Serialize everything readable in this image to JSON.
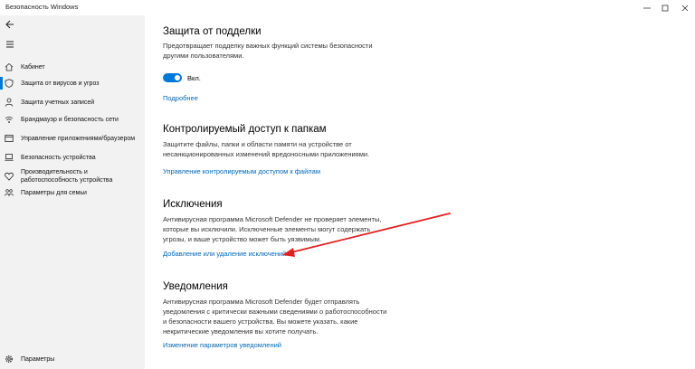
{
  "window": {
    "title": "Безопасность Windows",
    "controls": {
      "minimize": "—",
      "maximize": "☐",
      "close": "✕"
    }
  },
  "sidebar": {
    "items": [
      {
        "label": "Кабинет",
        "icon": "home-icon"
      },
      {
        "label": "Защита от вирусов и угроз",
        "icon": "shield-icon",
        "active": true
      },
      {
        "label": "Защита учетных записей",
        "icon": "person-icon"
      },
      {
        "label": "Брандмауэр и безопасность сети",
        "icon": "wifi-icon"
      },
      {
        "label": "Управление приложениями/браузером",
        "icon": "app-browser-icon"
      },
      {
        "label": "Безопасность устройства",
        "icon": "laptop-icon"
      },
      {
        "label": "Производительность и работоспособность устройства",
        "icon": "heart-icon"
      },
      {
        "label": "Параметры для семьи",
        "icon": "family-icon"
      }
    ],
    "settings_label": "Параметры"
  },
  "main": {
    "tamper": {
      "title": "Защита от подделки",
      "desc": "Предотвращает подделку важных функций системы безопасности другими пользователями.",
      "toggle_label": "Вкл.",
      "toggle_on": true,
      "link": "Подробнее"
    },
    "folder_access": {
      "title": "Контролируемый доступ к папкам",
      "desc": "Защитите файлы, папки и области памяти на устройстве от несанкционированных изменений вредоносными приложениями.",
      "link": "Управление контролируемым доступом к файлам"
    },
    "exclusions": {
      "title": "Исключения",
      "desc": "Антивирусная программа Microsoft Defender не проверяет элементы, которые вы исключили. Исключенные элементы могут содержать угрозы, и ваше устройство может быть уязвимым.",
      "link": "Добавление или удаление исключений"
    },
    "notifications": {
      "title": "Уведомления",
      "desc": "Антивирусная программа Microsoft Defender будет отправлять уведомления с критически важными сведениями о работоспособности и безопасности вашего устройства. Вы можете указать, какие некритические уведомления вы хотите получать.",
      "link": "Изменение параметров уведомлений"
    }
  },
  "colors": {
    "accent": "#0078d7",
    "link": "#0067b8",
    "annotation_arrow": "#e02020",
    "sidebar_bg": "#f2f2f2"
  }
}
